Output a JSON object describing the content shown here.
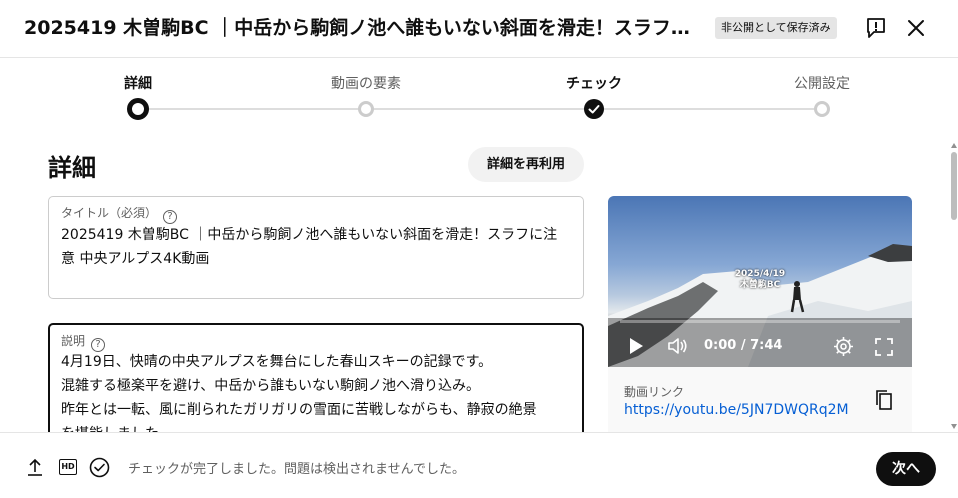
{
  "header": {
    "title": "2025419 木曽駒BC ｜中岳から駒飼ノ池へ誰もいない斜面を滑走！スラフに注意 中央アルプス4K動画",
    "visibility_badge": "非公開として保存済み"
  },
  "steps": [
    {
      "label": "詳細",
      "state": "current"
    },
    {
      "label": "動画の要素",
      "state": "pending"
    },
    {
      "label": "チェック",
      "state": "done"
    },
    {
      "label": "公開設定",
      "state": "pending"
    }
  ],
  "details": {
    "heading": "詳細",
    "reuse_label": "詳細を再利用",
    "title_field": {
      "label": "タイトル（必須）",
      "value": "2025419 木曽駒BC ｜中岳から駒飼ノ池へ誰もいない斜面を滑走！スラフに注意 中央アルプス4K動画"
    },
    "description_field": {
      "label": "説明",
      "lines": [
        "4月19日、快晴の中央アルプスを舞台にした春山スキーの記録です。",
        "混雑する極楽平を避け、中岳から誰もいない駒飼ノ池へ滑り込み。",
        "昨年とは一転、風に削られたガリガリの雪面に苦戦しながらも、静寂の絶景",
        "を堪能しました。"
      ]
    }
  },
  "video": {
    "overlay_date": "2025/4/19",
    "overlay_place": "木曽駒BC",
    "time": "0:00 / 7:44",
    "progress": 0.0,
    "link_label": "動画リンク",
    "link_url": "https://youtu.be/5JN7DWQRq2M"
  },
  "footer": {
    "status": "チェックが完了しました。問題は検出されませんでした。",
    "next_label": "次へ",
    "hd_label": "HD"
  },
  "colors": {
    "text": "#0f0f0f",
    "secondary": "#606060",
    "link": "#065fd4",
    "badge_bg": "#e5e5e5"
  }
}
